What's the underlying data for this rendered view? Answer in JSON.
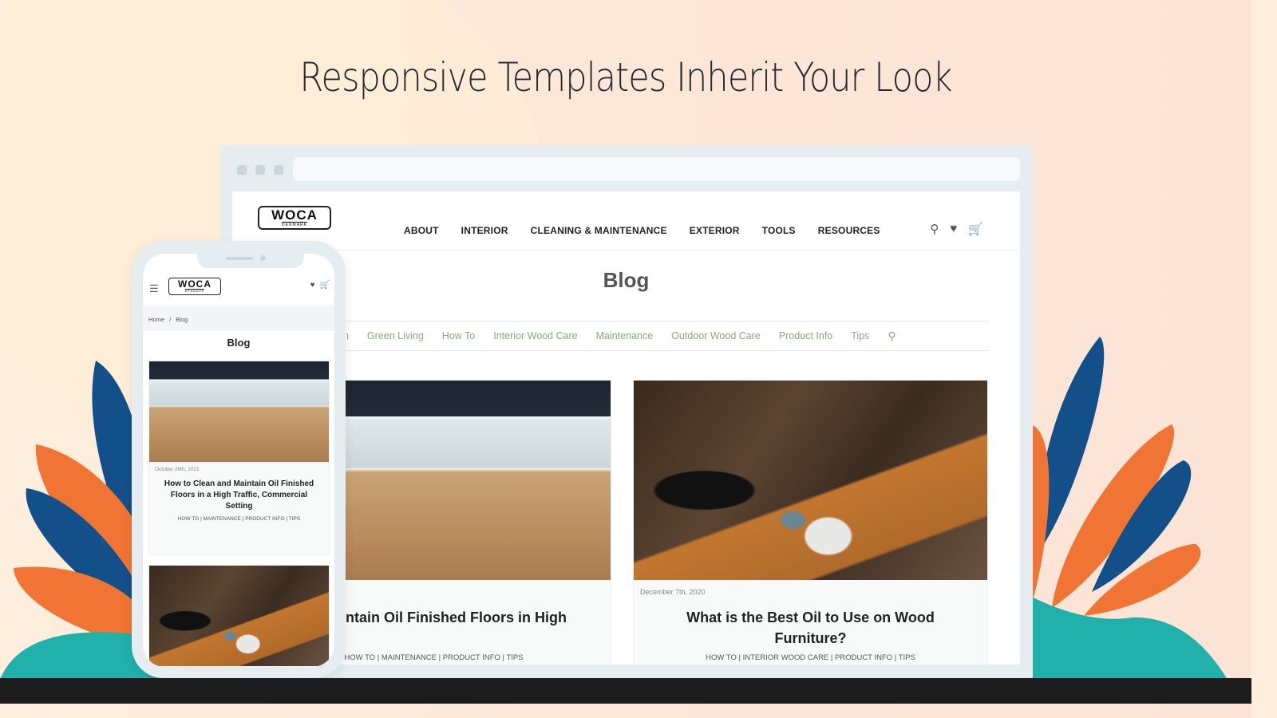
{
  "headline": "Responsive Templates Inherit Your Look",
  "colors": {
    "accent_green": "#8ba883",
    "leaf_blue": "#13508a",
    "leaf_orange": "#f07535",
    "teal": "#22b0ab",
    "frame": "#e6edf1"
  },
  "brand": {
    "logo_word": "WOCA",
    "logo_sub": "DENMARK"
  },
  "desktop": {
    "nav": [
      "ABOUT",
      "INTERIOR",
      "CLEANING & MAINTENANCE",
      "EXTERIOR",
      "TOOLS",
      "RESOURCES"
    ],
    "header_icons": [
      "search-icon",
      "heart-icon",
      "cart-icon"
    ],
    "page_title": "Blog",
    "categories": [
      "gn",
      "Green Living",
      "How To",
      "Interior Wood Care",
      "Maintenance",
      "Outdoor Wood Care",
      "Product Info",
      "Tips"
    ],
    "posts": [
      {
        "title": "Clean and Maintain Oil Finished Floors in High Traffic",
        "tags": "HOW TO | MAINTENANCE | PRODUCT INFO | TIPS",
        "image": "restaurant-wood-floor"
      },
      {
        "date": "December 7th, 2020",
        "title": "What is the Best Oil to Use on Wood Furniture?",
        "tags": "HOW TO | INTERIOR WOOD CARE | PRODUCT INFO | TIPS",
        "image": "coffee-cup-table"
      }
    ]
  },
  "mobile": {
    "breadcrumb": [
      "Home",
      "/",
      "Blog"
    ],
    "page_title": "Blog",
    "posts": [
      {
        "date": "October 26th, 2021",
        "title": "How to Clean and Maintain Oil Finished Floors in a High Traffic, Commercial Setting",
        "tags": "HOW TO | MAINTENANCE | PRODUCT INFO | TIPS",
        "image": "restaurant-wood-floor"
      },
      {
        "image": "coffee-cup-table"
      }
    ]
  }
}
